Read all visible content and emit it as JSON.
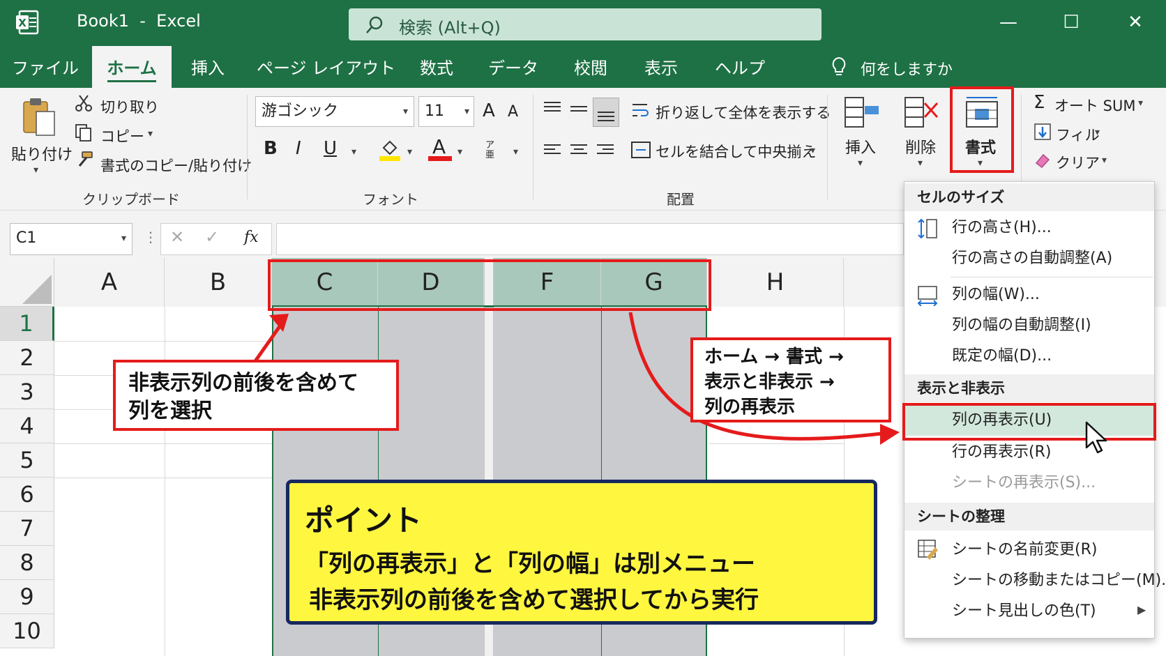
{
  "window": {
    "title": "Book1  -  Excel",
    "search_placeholder": "検索 (Alt+Q)"
  },
  "tabs": [
    "ファイル",
    "ホーム",
    "挿入",
    "ページ レイアウト",
    "数式",
    "データ",
    "校閲",
    "表示",
    "ヘルプ"
  ],
  "tell_me": "何をしますか",
  "ribbon": {
    "clipboard": {
      "paste": "貼り付け",
      "cut": "切り取り",
      "copy": "コピー",
      "format_painter": "書式のコピー/貼り付け",
      "group": "クリップボード"
    },
    "font": {
      "name": "游ゴシック",
      "size": "11",
      "grow": "A",
      "shrink": "A",
      "bold": "B",
      "italic": "I",
      "underline": "U",
      "font_color_letter": "A",
      "phonetic": "ア亜",
      "group": "フォント"
    },
    "alignment": {
      "wrap": "折り返して全体を表示する",
      "merge": "セルを結合して中央揃え",
      "group": "配置"
    },
    "cells": {
      "insert": "挿入",
      "delete": "削除",
      "format": "書式"
    },
    "editing": {
      "autosum": "オート SUM",
      "fill": "フィル",
      "clear": "クリア"
    }
  },
  "namebox": "C1",
  "fx": "fx",
  "columns": [
    "A",
    "B",
    "C",
    "D",
    "F",
    "G",
    "H"
  ],
  "rows": [
    "1",
    "2",
    "3",
    "4",
    "5",
    "6",
    "7",
    "8",
    "9",
    "10"
  ],
  "callout_left": {
    "line1": "非表示列の前後を含めて",
    "line2": "列を選択"
  },
  "callout_right": {
    "line1": "ホーム → 書式 →",
    "line2": "表示と非表示 →",
    "line3": "列の再表示"
  },
  "point": {
    "title": "ポイント",
    "line1": "「列の再表示」と「列の幅」は別メニュー",
    "line2": "非表示列の前後を含めて選択してから実行"
  },
  "menu": {
    "h1": "セルのサイズ",
    "row_height": "行の高さ(H)...",
    "row_autofit": "行の高さの自動調整(A)",
    "col_width": "列の幅(W)...",
    "col_autofit": "列の幅の自動調整(I)",
    "default_width": "既定の幅(D)...",
    "h2": "表示と非表示",
    "unhide_cols": "列の再表示(U)",
    "unhide_rows": "行の再表示(R)",
    "unhide_sheet": "シートの再表示(S)...",
    "h3": "シートの整理",
    "rename": "シートの名前変更(R)",
    "move_copy": "シートの移動またはコピー(M)...",
    "tab_color": "シート見出しの色(T)"
  },
  "colors": {
    "excel_green": "#1e7145",
    "highlight_red": "#e51b1b",
    "point_yellow": "#fff640",
    "point_border": "#17285f"
  }
}
